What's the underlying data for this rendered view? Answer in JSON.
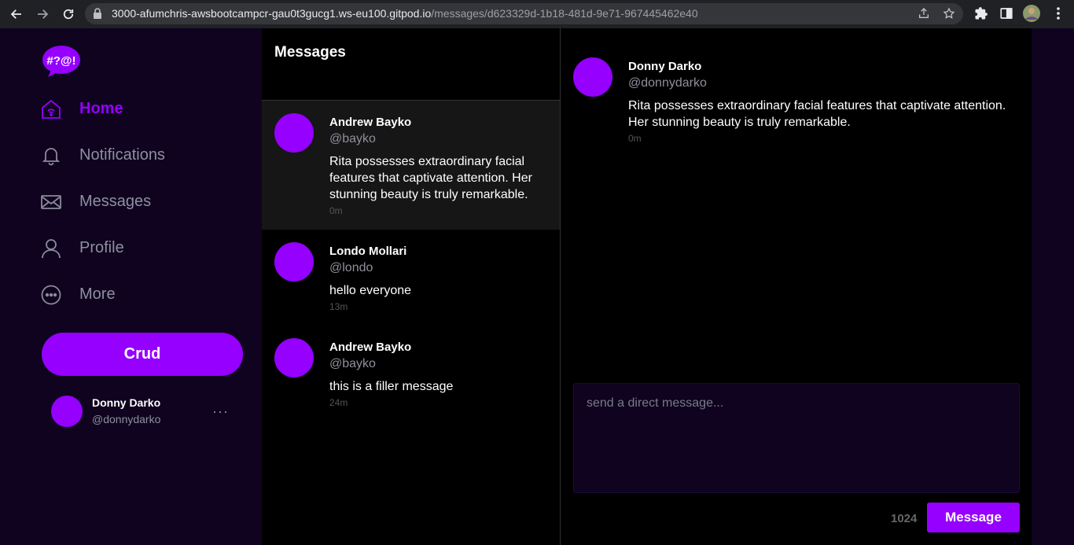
{
  "browser": {
    "url_host": "3000-afumchris-awsbootcampcr-gau0t3gucg1.ws-eu100.gitpod.io",
    "url_path": "/messages/d623329d-1b18-481d-9e71-967445462e40"
  },
  "logo": {
    "text": "#?@!"
  },
  "sidebar": {
    "items": [
      {
        "label": "Home",
        "icon": "home-icon",
        "active": true
      },
      {
        "label": "Notifications",
        "icon": "bell-icon",
        "active": false
      },
      {
        "label": "Messages",
        "icon": "mail-icon",
        "active": false
      },
      {
        "label": "Profile",
        "icon": "user-icon",
        "active": false
      },
      {
        "label": "More",
        "icon": "more-icon",
        "active": false
      }
    ],
    "crud_label": "Crud",
    "user": {
      "name": "Donny Darko",
      "handle": "@donnydarko",
      "more": "···"
    }
  },
  "groups": {
    "title": "Messages",
    "items": [
      {
        "name": "Andrew Bayko",
        "handle": "@bayko",
        "body": "Rita possesses extraordinary facial features that captivate attention. Her stunning beauty is truly remarkable.",
        "time": "0m"
      },
      {
        "name": "Londo Mollari",
        "handle": "@londo",
        "body": "hello everyone",
        "time": "13m"
      },
      {
        "name": "Andrew Bayko",
        "handle": "@bayko",
        "body": "this is a filler message",
        "time": "24m"
      }
    ]
  },
  "conversation": {
    "name": "Donny Darko",
    "handle": "@donnydarko",
    "body": "Rita possesses extraordinary facial features that captivate attention. Her stunning beauty is truly remarkable.",
    "time": "0m",
    "input_placeholder": "send a direct message...",
    "count": "1024",
    "send_label": "Message"
  },
  "colors": {
    "accent": "#9500ff",
    "sidebar_bg": "#0f0320",
    "panel_bg": "#000000"
  }
}
